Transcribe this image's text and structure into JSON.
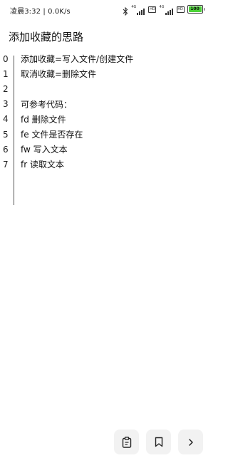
{
  "status_bar": {
    "time": "凌晨3:32 | 0.0K/s",
    "network_label_1": "4G",
    "network_label_2": "4G",
    "hd_badge": "HD",
    "battery_level": "100",
    "icons": [
      "bluetooth-icon",
      "signal-icon",
      "hd-icon",
      "signal-icon",
      "hd-icon",
      "battery-icon"
    ]
  },
  "header": {
    "title": "添加收藏的思路"
  },
  "editor": {
    "lines": [
      {
        "number": "0",
        "text": "添加收藏=写入文件/创建文件"
      },
      {
        "number": "1",
        "text": "取消收藏=删除文件"
      },
      {
        "number": "2",
        "text": ""
      },
      {
        "number": "3",
        "text": "可参考代码："
      },
      {
        "number": "4",
        "text": "fd 删除文件"
      },
      {
        "number": "5",
        "text": "fe 文件是否存在"
      },
      {
        "number": "6",
        "text": "fw 写入文本"
      },
      {
        "number": "7",
        "text": "fr 读取文本"
      }
    ]
  },
  "toolbar": {
    "buttons": [
      {
        "icon": "clipboard-icon"
      },
      {
        "icon": "bookmark-icon"
      },
      {
        "icon": "chevron-right-icon"
      }
    ]
  },
  "colors": {
    "battery": "#4cd137",
    "button_bg": "#f2f2f2",
    "text": "#111111"
  }
}
